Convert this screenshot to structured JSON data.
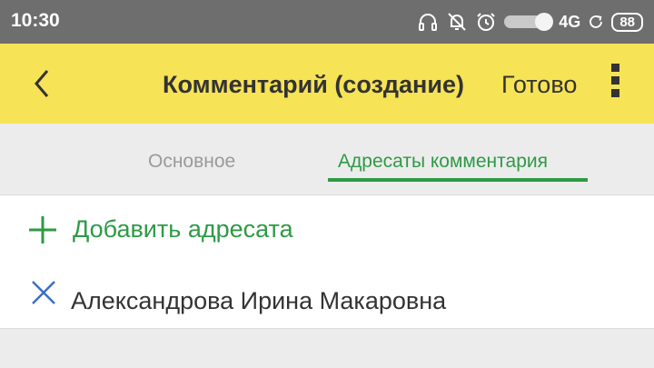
{
  "status_bar": {
    "time": "10:30",
    "network": "4G",
    "battery": "88",
    "icons": [
      "headset-icon",
      "notifications-off-icon",
      "alarm-icon",
      "toggle-icon",
      "sync-icon",
      "battery-icon"
    ]
  },
  "app_bar": {
    "title": "Комментарий (создание)",
    "done_label": "Готово",
    "back_icon": "chevron-left-icon",
    "more_icon": "more-vertical-icon"
  },
  "tabs": [
    {
      "label": "Основное",
      "active": false
    },
    {
      "label": "Адресаты комментария",
      "active": true
    }
  ],
  "content": {
    "add_recipient_label": "Добавить адресата",
    "recipients": [
      {
        "name": "Александрова Ирина Макаровна"
      }
    ]
  },
  "colors": {
    "accent": "#2e9a46",
    "app_bar": "#f6e356",
    "status_bar": "#6e6e6e",
    "remove_icon": "#3b6fc4"
  }
}
